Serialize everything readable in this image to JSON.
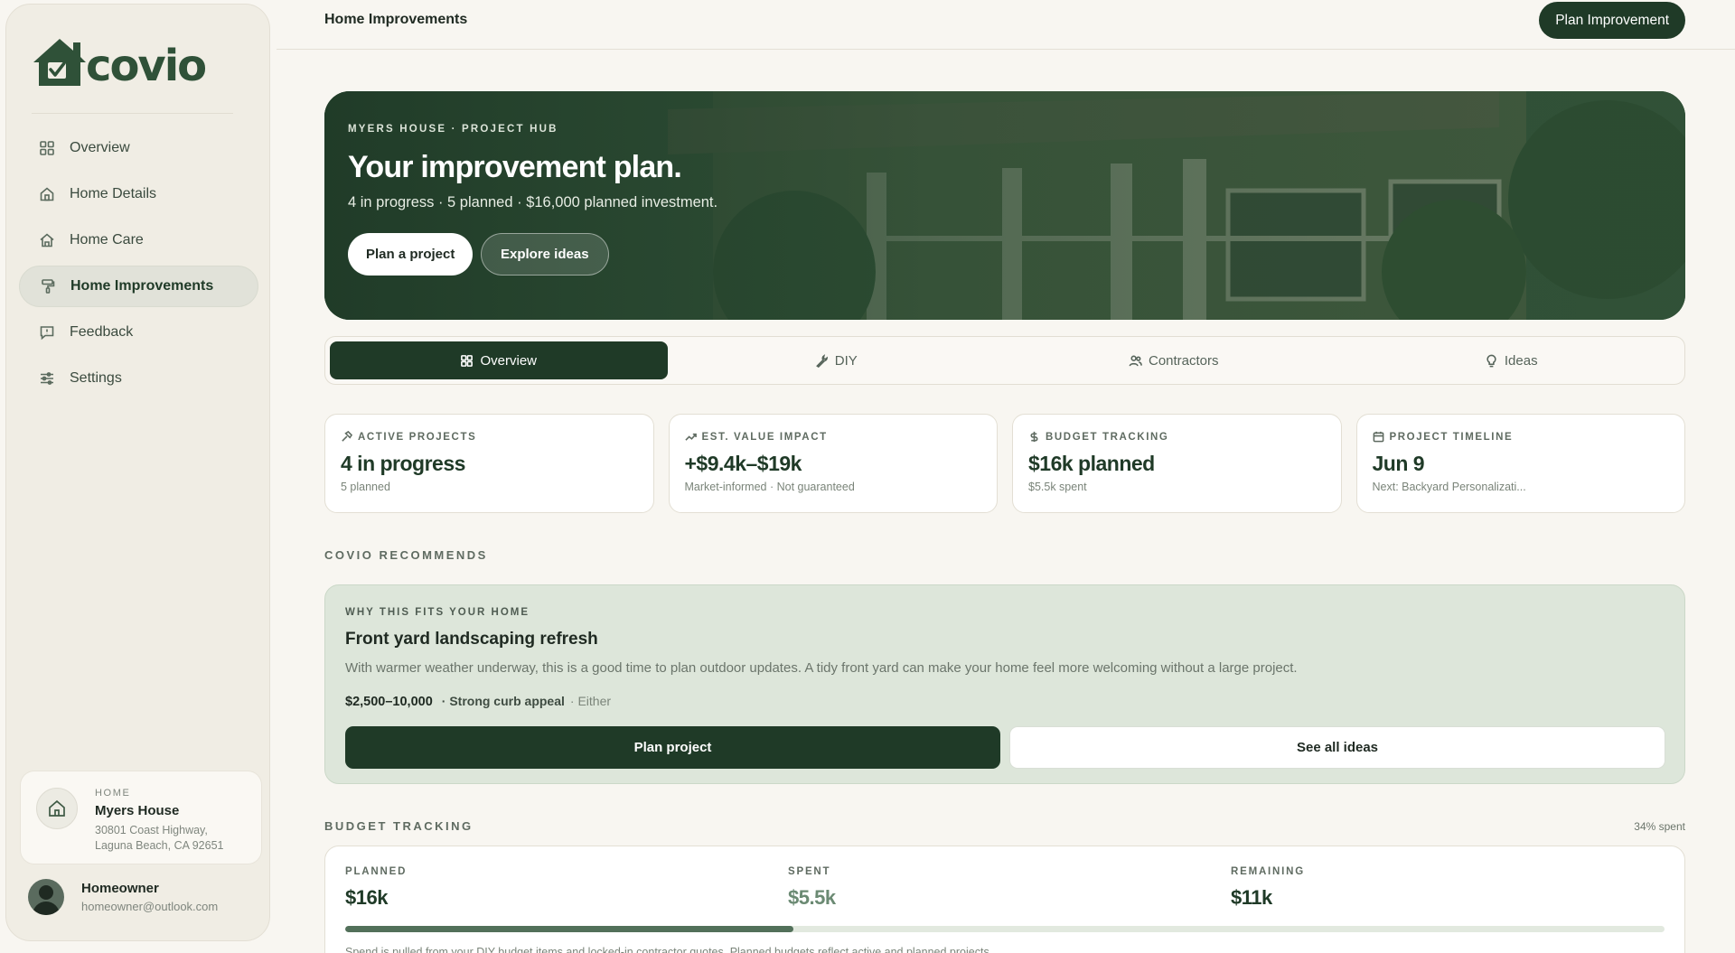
{
  "app": {
    "logo_text": "covio"
  },
  "sidebar": {
    "items": [
      {
        "label": "Overview",
        "icon": "grid-icon"
      },
      {
        "label": "Home Details",
        "icon": "house-icon"
      },
      {
        "label": "Home Care",
        "icon": "home-care-icon"
      },
      {
        "label": "Home Improvements",
        "icon": "paint-roller-icon",
        "active": true
      },
      {
        "label": "Feedback",
        "icon": "message-icon"
      },
      {
        "label": "Settings",
        "icon": "sliders-icon"
      }
    ],
    "home_card": {
      "label": "HOME",
      "name": "Myers House",
      "address_line1": "30801 Coast Highway,",
      "address_line2": "Laguna Beach, CA 92651"
    },
    "user": {
      "name": "Homeowner",
      "email": "homeowner@outlook.com"
    }
  },
  "header": {
    "title": "Home Improvements",
    "cta_label": "Plan Improvement"
  },
  "hero": {
    "eyebrow": "MYERS HOUSE · PROJECT HUB",
    "title": "Your improvement plan.",
    "subtitle": "4 in progress · 5 planned · $16,000 planned investment.",
    "primary_label": "Plan a project",
    "secondary_label": "Explore ideas"
  },
  "tabs": [
    {
      "label": "Overview",
      "icon": "grid-icon",
      "active": true
    },
    {
      "label": "DIY",
      "icon": "wrench-icon"
    },
    {
      "label": "Contractors",
      "icon": "users-icon"
    },
    {
      "label": "Ideas",
      "icon": "lightbulb-icon"
    }
  ],
  "stats": [
    {
      "label": "ACTIVE PROJECTS",
      "value": "4 in progress",
      "sub": "5 planned",
      "icon": "hammer-icon"
    },
    {
      "label": "EST. VALUE IMPACT",
      "value": "+$9.4k–$19k",
      "sub": "Market-informed · Not guaranteed",
      "icon": "trend-up-icon"
    },
    {
      "label": "BUDGET TRACKING",
      "value": "$16k planned",
      "sub": "$5.5k spent",
      "icon": "dollar-icon"
    },
    {
      "label": "PROJECT TIMELINE",
      "value": "Jun 9",
      "sub": "Next: Backyard Personalizati...",
      "icon": "calendar-icon"
    }
  ],
  "recommends": {
    "section_title": "COVIO RECOMMENDS",
    "eyebrow": "WHY THIS FITS YOUR HOME",
    "title": "Front yard landscaping refresh",
    "description": "With warmer weather underway, this is a good time to plan outdoor updates. A tidy front yard can make your home feel more welcoming without a large project.",
    "price": "$2,500–10,000",
    "impact": "· Strong curb appeal",
    "mode": "· Either",
    "primary_label": "Plan project",
    "secondary_label": "See all ideas"
  },
  "budget": {
    "section_title": "BUDGET TRACKING",
    "percent_label": "34% spent",
    "progress_fraction": 0.34,
    "planned_label": "PLANNED",
    "planned_value": "$16k",
    "spent_label": "SPENT",
    "spent_value": "$5.5k",
    "remaining_label": "REMAINING",
    "remaining_value": "$11k",
    "note": "Spend is pulled from your DIY budget items and locked-in contractor quotes. Planned budgets reflect active and planned projects."
  },
  "colors": {
    "brand": "#1f3a27",
    "accent": "#52705a",
    "rec_bg": "#dde6da",
    "spent_text": "#6b8a73"
  }
}
